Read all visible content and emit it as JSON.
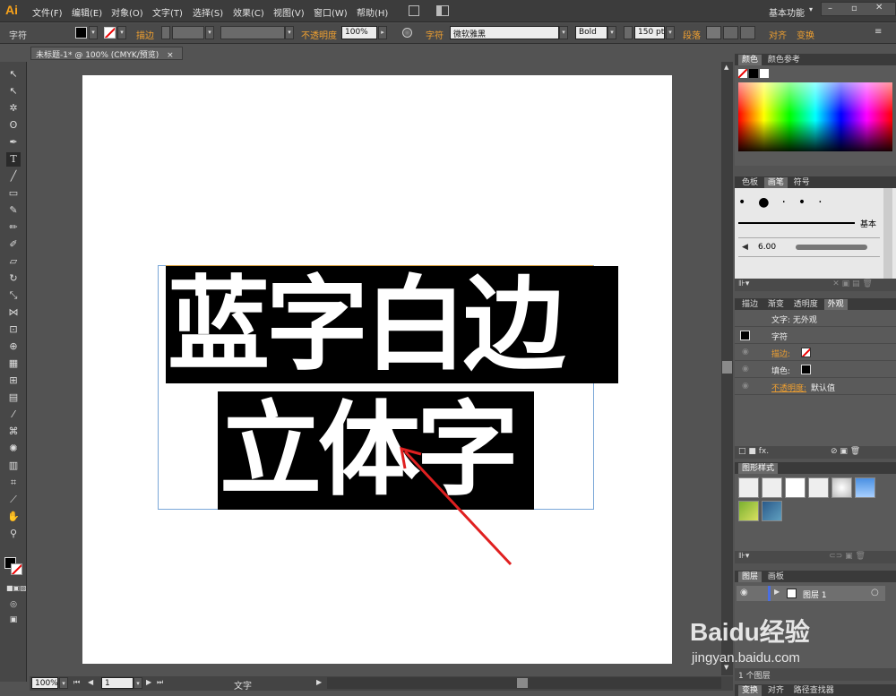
{
  "app": {
    "logo": "Ai",
    "workspace": "基本功能"
  },
  "menu": [
    "文件(F)",
    "编辑(E)",
    "对象(O)",
    "文字(T)",
    "选择(S)",
    "效果(C)",
    "视图(V)",
    "窗口(W)",
    "帮助(H)"
  ],
  "control_bar": {
    "mode_label": "字符",
    "stroke_label": "描边",
    "opacity_label": "不透明度",
    "opacity_value": "100%",
    "char_label": "字符",
    "font_family": "微软雅黑",
    "font_style": "Bold",
    "font_size": "150 pt",
    "paragraph_label": "段落",
    "align_label": "对齐",
    "transform_label": "变换"
  },
  "document": {
    "tab_title": "未标题-1* @ 100% (CMYK/预览)",
    "line1": "蓝字白边",
    "line2": "立体字",
    "zoom": "100%",
    "page": "1",
    "status": "文字"
  },
  "panels": {
    "color": {
      "tabs": [
        "颜色",
        "颜色参考"
      ]
    },
    "brush": {
      "tabs": [
        "色板",
        "画笔",
        "符号"
      ],
      "basic_label": "基本",
      "size_value": "6.00"
    },
    "appearance": {
      "tabs": [
        "描边",
        "渐变",
        "透明度",
        "外观"
      ],
      "title": "文字: 无外观",
      "char_label": "字符",
      "stroke_label": "描边:",
      "fill_label": "填色:",
      "opacity_label": "不透明度:",
      "opacity_value": "默认值"
    },
    "graphic_styles": {
      "tabs": [
        "图形样式"
      ]
    },
    "layers": {
      "tabs": [
        "图层",
        "画板"
      ],
      "layer_name": "图层 1",
      "footer": "1 个图层"
    },
    "bottom_tabs": [
      "变换",
      "对齐",
      "路径查找器"
    ]
  },
  "watermark": {
    "brand": "Baidu经验",
    "url": "jingyan.baidu.com"
  },
  "colors": {
    "accent": "#f0a030",
    "arrow": "#e02020",
    "selection": "#6fa8dc"
  }
}
